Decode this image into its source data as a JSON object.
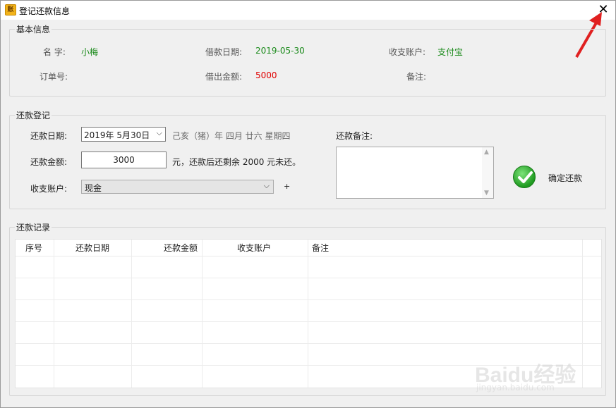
{
  "window": {
    "title": "登记还款信息",
    "app_icon_text": "账",
    "close_glyph": "✕"
  },
  "basic_info": {
    "label": "基本信息",
    "name_label": "名  字:",
    "name_value": "小梅",
    "loan_date_label": "借款日期:",
    "loan_date_value": "2019-05-30",
    "account_label": "收支账户:",
    "account_value": "支付宝",
    "order_no_label": "订单号:",
    "order_no_value": "",
    "loan_amount_label": "借出金额:",
    "loan_amount_value": "5000",
    "remark_label": "备注:",
    "remark_value": ""
  },
  "repay": {
    "label": "还款登记",
    "date_label": "还款日期:",
    "date_value": "2019年  5月30日",
    "lunar_text": "己亥（猪）年 四月 廿六 星期四",
    "amount_label": "还款金额:",
    "amount_value": "3000",
    "remaining_text": "元，还款后还剩余 2000 元未还。",
    "account_label": "收支账户:",
    "account_value": "现金",
    "add_label": "+",
    "memo_label": "还款备注:",
    "memo_value": "",
    "confirm_label": "确定还款"
  },
  "records": {
    "label": "还款记录",
    "columns": [
      "序号",
      "还款日期",
      "还款金额",
      "收支账户",
      "备注"
    ],
    "rows": []
  },
  "watermark": {
    "text": "Baidu经验",
    "sub": "jingyan.baidu.com"
  },
  "colors": {
    "green": "#1a8a1a",
    "red": "#e00000",
    "accent_arrow": "#e02020"
  }
}
